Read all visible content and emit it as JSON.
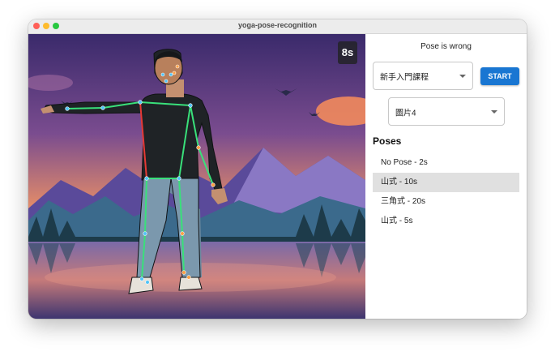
{
  "window": {
    "title": "yoga-pose-recognition"
  },
  "video": {
    "timer": "8s"
  },
  "panel": {
    "status": "Pose is wrong",
    "course_select": {
      "value": "新手入門課程"
    },
    "start_button": {
      "label": "START",
      "color": "#1976d2"
    },
    "image_select": {
      "value": "圖片4"
    },
    "poses_heading": "Poses",
    "poses": [
      {
        "label": "No Pose - 2s"
      },
      {
        "label": "山式 - 10s",
        "selected": true
      },
      {
        "label": "三角式 - 20s"
      },
      {
        "label": "山式 - 5s"
      }
    ]
  },
  "colors": {
    "left_limb": "#39e07a",
    "right_limb": "#e53935",
    "keypoint": "#4fc3f7"
  }
}
